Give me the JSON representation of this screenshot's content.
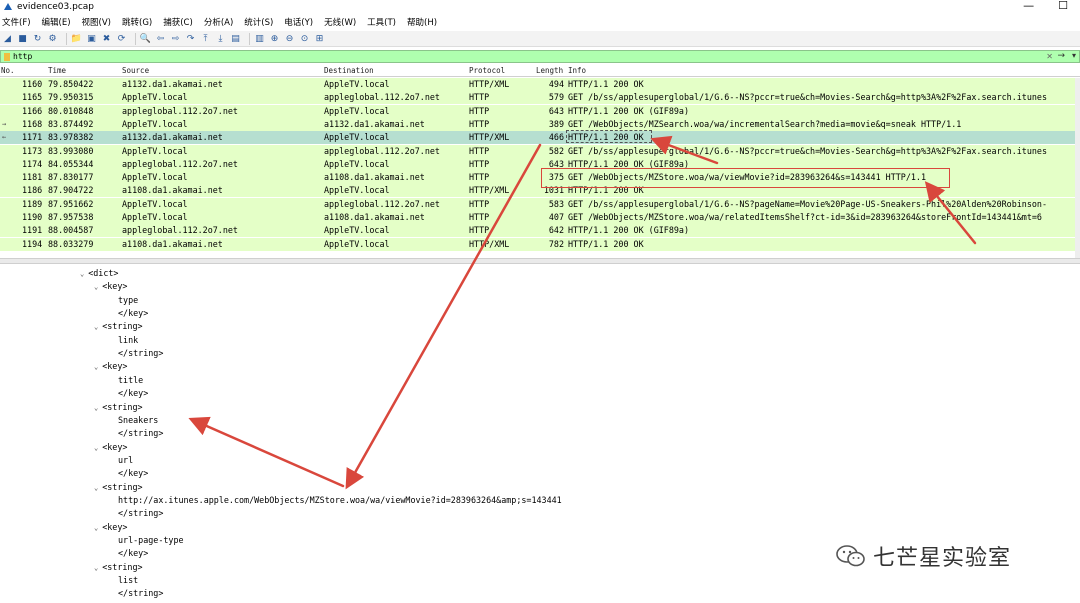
{
  "window": {
    "title": "evidence03.pcap"
  },
  "menu": [
    "文件(F)",
    "编辑(E)",
    "视图(V)",
    "跳转(G)",
    "捕获(C)",
    "分析(A)",
    "统计(S)",
    "电话(Y)",
    "无线(W)",
    "工具(T)",
    "帮助(H)"
  ],
  "toolbar_icons": [
    "shark-fin-icon",
    "stop-icon",
    "restart-icon",
    "options-icon",
    "open-file-icon",
    "save-icon",
    "close-file-icon",
    "reload-icon",
    "find-icon",
    "back-icon",
    "forward-icon",
    "go-to-icon",
    "first-icon",
    "last-icon",
    "autoscroll-icon",
    "colorize-icon",
    "zoom-in-icon",
    "zoom-out-icon",
    "zoom-reset-icon",
    "resize-columns-icon"
  ],
  "filter": {
    "value": "http"
  },
  "columns": [
    "No.",
    "Time",
    "Source",
    "Destination",
    "Protocol",
    "Length",
    "Info"
  ],
  "packets": [
    {
      "no": "1160",
      "time": "79.850422",
      "src": "a1132.da1.akamai.net",
      "dst": "AppleTV.local",
      "proto": "HTTP/XML",
      "len": "494",
      "info": "HTTP/1.1 200 OK"
    },
    {
      "no": "1165",
      "time": "79.950315",
      "src": "AppleTV.local",
      "dst": "appleglobal.112.2o7.net",
      "proto": "HTTP",
      "len": "579",
      "info": "GET /b/ss/applesuperglobal/1/G.6--NS?pccr=true&ch=Movies-Search&g=http%3A%2F%2Fax.search.itunes"
    },
    {
      "no": "1166",
      "time": "80.010848",
      "src": "appleglobal.112.2o7.net",
      "dst": "AppleTV.local",
      "proto": "HTTP",
      "len": "643",
      "info": "HTTP/1.1 200 OK  (GIF89a)"
    },
    {
      "no": "1168",
      "time": "83.874492",
      "src": "AppleTV.local",
      "dst": "a1132.da1.akamai.net",
      "proto": "HTTP",
      "len": "389",
      "info": "GET /WebObjects/MZSearch.woa/wa/incrementalSearch?media=movie&q=sneak HTTP/1.1",
      "marker": "→"
    },
    {
      "no": "1171",
      "time": "83.978382",
      "src": "a1132.da1.akamai.net",
      "dst": "AppleTV.local",
      "proto": "HTTP/XML",
      "len": "466",
      "info": "HTTP/1.1 200 OK",
      "selected": true,
      "marker": "←"
    },
    {
      "no": "1173",
      "time": "83.993080",
      "src": "AppleTV.local",
      "dst": "appleglobal.112.2o7.net",
      "proto": "HTTP",
      "len": "582",
      "info": "GET /b/ss/applesuperglobal/1/G.6--NS?pccr=true&ch=Movies-Search&g=http%3A%2F%2Fax.search.itunes"
    },
    {
      "no": "1174",
      "time": "84.055344",
      "src": "appleglobal.112.2o7.net",
      "dst": "AppleTV.local",
      "proto": "HTTP",
      "len": "643",
      "info": "HTTP/1.1 200 OK  (GIF89a)"
    },
    {
      "no": "1181",
      "time": "87.830177",
      "src": "AppleTV.local",
      "dst": "a1108.da1.akamai.net",
      "proto": "HTTP",
      "len": "375",
      "info": "GET /WebObjects/MZStore.woa/wa/viewMovie?id=283963264&s=143441 HTTP/1.1"
    },
    {
      "no": "1186",
      "time": "87.904722",
      "src": "a1108.da1.akamai.net",
      "dst": "AppleTV.local",
      "proto": "HTTP/XML",
      "len": "1031",
      "info": "HTTP/1.1 200 OK"
    },
    {
      "no": "1189",
      "time": "87.951662",
      "src": "AppleTV.local",
      "dst": "appleglobal.112.2o7.net",
      "proto": "HTTP",
      "len": "583",
      "info": "GET /b/ss/applesuperglobal/1/G.6--NS?pageName=Movie%20Page-US-Sneakers-Phil%20Alden%20Robinson-"
    },
    {
      "no": "1190",
      "time": "87.957538",
      "src": "AppleTV.local",
      "dst": "a1108.da1.akamai.net",
      "proto": "HTTP",
      "len": "407",
      "info": "GET /WebObjects/MZStore.woa/wa/relatedItemsShelf?ct-id=3&id=283963264&storeFrontId=143441&mt=6"
    },
    {
      "no": "1191",
      "time": "88.004587",
      "src": "appleglobal.112.2o7.net",
      "dst": "AppleTV.local",
      "proto": "HTTP",
      "len": "642",
      "info": "HTTP/1.1 200 OK  (GIF89a)"
    },
    {
      "no": "1194",
      "time": "88.033279",
      "src": "a1108.da1.akamai.net",
      "dst": "AppleTV.local",
      "proto": "HTTP/XML",
      "len": "782",
      "info": "HTTP/1.1 200 OK"
    }
  ],
  "detail_lines": [
    {
      "indent": 0,
      "expander": "⌄",
      "text": "<dict>"
    },
    {
      "indent": 1,
      "expander": "⌄",
      "text": "<key>"
    },
    {
      "indent": 2,
      "expander": "",
      "text": "type"
    },
    {
      "indent": 2,
      "expander": "",
      "text": "</key>"
    },
    {
      "indent": 1,
      "expander": "⌄",
      "text": "<string>"
    },
    {
      "indent": 2,
      "expander": "",
      "text": "link"
    },
    {
      "indent": 2,
      "expander": "",
      "text": "</string>"
    },
    {
      "indent": 1,
      "expander": "⌄",
      "text": "<key>"
    },
    {
      "indent": 2,
      "expander": "",
      "text": "title"
    },
    {
      "indent": 2,
      "expander": "",
      "text": "</key>"
    },
    {
      "indent": 1,
      "expander": "⌄",
      "text": "<string>"
    },
    {
      "indent": 2,
      "expander": "",
      "text": "Sneakers"
    },
    {
      "indent": 2,
      "expander": "",
      "text": "</string>"
    },
    {
      "indent": 1,
      "expander": "⌄",
      "text": "<key>"
    },
    {
      "indent": 2,
      "expander": "",
      "text": "url"
    },
    {
      "indent": 2,
      "expander": "",
      "text": "</key>"
    },
    {
      "indent": 1,
      "expander": "⌄",
      "text": "<string>"
    },
    {
      "indent": 2,
      "expander": "",
      "text": "http://ax.itunes.apple.com/WebObjects/MZStore.woa/wa/viewMovie?id=283963264&amp;s=143441"
    },
    {
      "indent": 2,
      "expander": "",
      "text": "</string>"
    },
    {
      "indent": 1,
      "expander": "⌄",
      "text": "<key>"
    },
    {
      "indent": 2,
      "expander": "",
      "text": "url-page-type"
    },
    {
      "indent": 2,
      "expander": "",
      "text": "</key>"
    },
    {
      "indent": 1,
      "expander": "⌄",
      "text": "<string>"
    },
    {
      "indent": 2,
      "expander": "",
      "text": "list"
    },
    {
      "indent": 2,
      "expander": "",
      "text": "</string>"
    }
  ],
  "watermark": {
    "text": "七芒星实验室"
  },
  "colors": {
    "row_bg": "#e4ffc7",
    "row_selected": "#b6dfd0",
    "filter_bg": "#afffaf",
    "annotation_red": "#d9473c"
  }
}
